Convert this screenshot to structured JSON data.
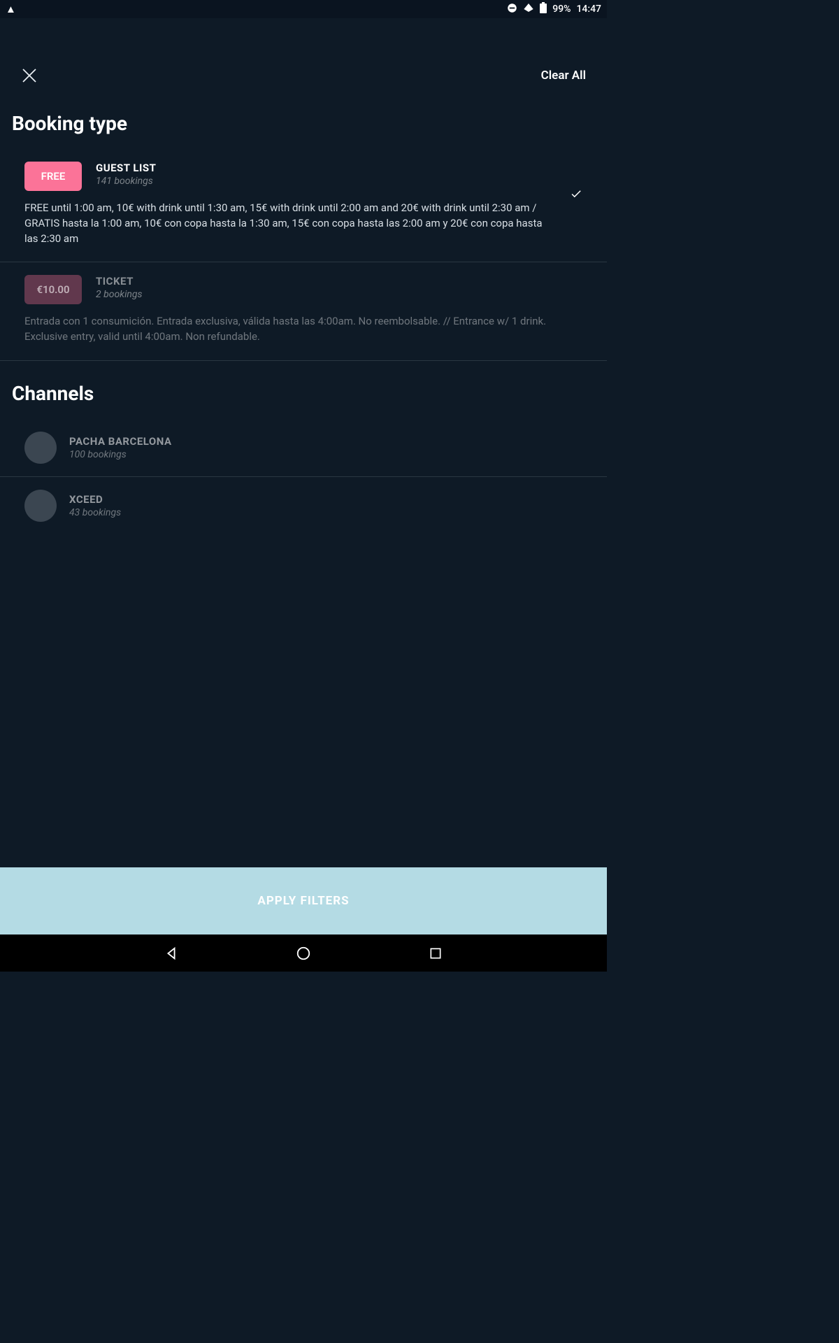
{
  "statusbar": {
    "battery_pct": "99%",
    "time": "14:47"
  },
  "header": {
    "clear_all": "Clear All"
  },
  "sections": {
    "booking_type_title": "Booking type",
    "channels_title": "Channels"
  },
  "booking_types": [
    {
      "price_label": "FREE",
      "name": "GUEST LIST",
      "count": "141 bookings",
      "desc": "FREE until 1:00 am, 10€ with drink until 1:30 am, 15€ with drink until 2:00 am and 20€ with drink until 2:30 am / GRATIS hasta la 1:00 am, 10€ con copa hasta la 1:30 am, 15€ con copa hasta las 2:00 am y 20€ con copa hasta las 2:30 am",
      "selected": true
    },
    {
      "price_label": "€10.00",
      "name": "TICKET",
      "count": "2 bookings",
      "desc": "Entrada con 1 consumición. Entrada exclusiva, válida hasta las 4:00am. No reembolsable. // Entrance w/ 1 drink. Exclusive entry, valid until 4:00am. Non refundable.",
      "selected": false
    }
  ],
  "channels": [
    {
      "name": "PACHA BARCELONA",
      "count": "100 bookings"
    },
    {
      "name": "XCEED",
      "count": "43 bookings"
    }
  ],
  "footer": {
    "apply_label": "APPLY FILTERS"
  }
}
